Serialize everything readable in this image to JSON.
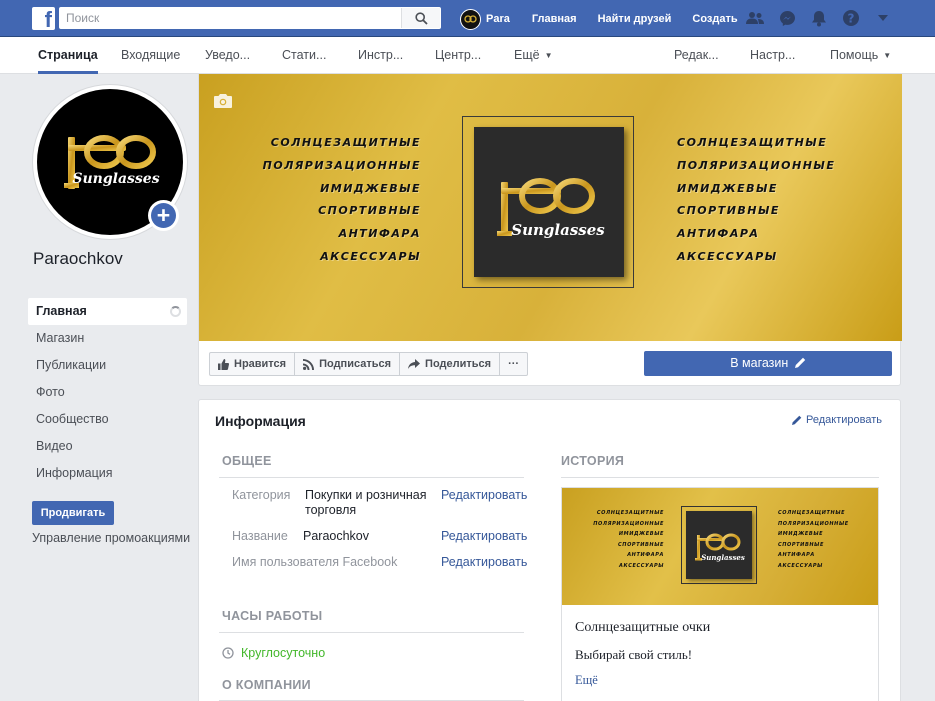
{
  "topbar": {
    "search_placeholder": "Поиск",
    "user_name": "Para",
    "links": [
      "Главная",
      "Найти друзей",
      "Создать"
    ]
  },
  "tabs": [
    {
      "label": "Страница",
      "active": true
    },
    {
      "label": "Входящие"
    },
    {
      "label": "Уведо..."
    },
    {
      "label": "Стати..."
    },
    {
      "label": "Инстр..."
    },
    {
      "label": "Центр..."
    },
    {
      "label": "Ещё",
      "caret": true
    },
    {
      "label": "Редак..."
    },
    {
      "label": "Настр..."
    },
    {
      "label": "Помощь",
      "caret": true
    }
  ],
  "profile": {
    "name": "Paraochkov",
    "logo_text": "Sunglasses"
  },
  "left_nav": {
    "items": [
      "Главная",
      "Магазин",
      "Публикации",
      "Фото",
      "Сообщество",
      "Видео",
      "Информация"
    ],
    "promote_label": "Продвигать",
    "promo_manage_label": "Управление промоакциями"
  },
  "cover": {
    "left_lines": [
      "СОЛНЦЕЗАЩИТНЫЕ",
      "ПОЛЯРИЗАЦИОННЫЕ",
      "ИМИДЖЕВЫЕ",
      "СПОРТИВНЫЕ",
      "АНТИФАРА",
      "АКСЕССУАРЫ"
    ],
    "right_lines": [
      "СОЛНЦЕЗАЩИТНЫЕ",
      "ПОЛЯРИЗАЦИОННЫЕ",
      "ИМИДЖЕВЫЕ",
      "СПОРТИВНЫЕ",
      "АНТИФАРА",
      "АКСЕССУАРЫ"
    ],
    "logo_text": "Sunglasses"
  },
  "actions": {
    "like": "Нравится",
    "follow": "Подписаться",
    "share": "Поделиться",
    "more": "···",
    "shop": "В магазин"
  },
  "info": {
    "title": "Информация",
    "edit": "Редактировать",
    "general_header": "ОБЩЕЕ",
    "category_label": "Категория",
    "category_value": "Покупки и розничная торговля",
    "name_label": "Название",
    "name_value": "Paraochkov",
    "username_label": "Имя пользователя Facebook",
    "row_edit": "Редактировать",
    "hours_header": "ЧАСЫ РАБОТЫ",
    "hours_value": "Круглосуточно",
    "about_header": "О КОМПАНИИ",
    "story_header": "ИСТОРИЯ",
    "story_title": "Солнцезащитные очки",
    "story_text": "Выбирай свой стиль!",
    "story_more": "Ещё"
  },
  "colors": {
    "brand_blue": "#4267b2",
    "gold": "#d8b13a",
    "link": "#365899",
    "green": "#42b72a"
  }
}
